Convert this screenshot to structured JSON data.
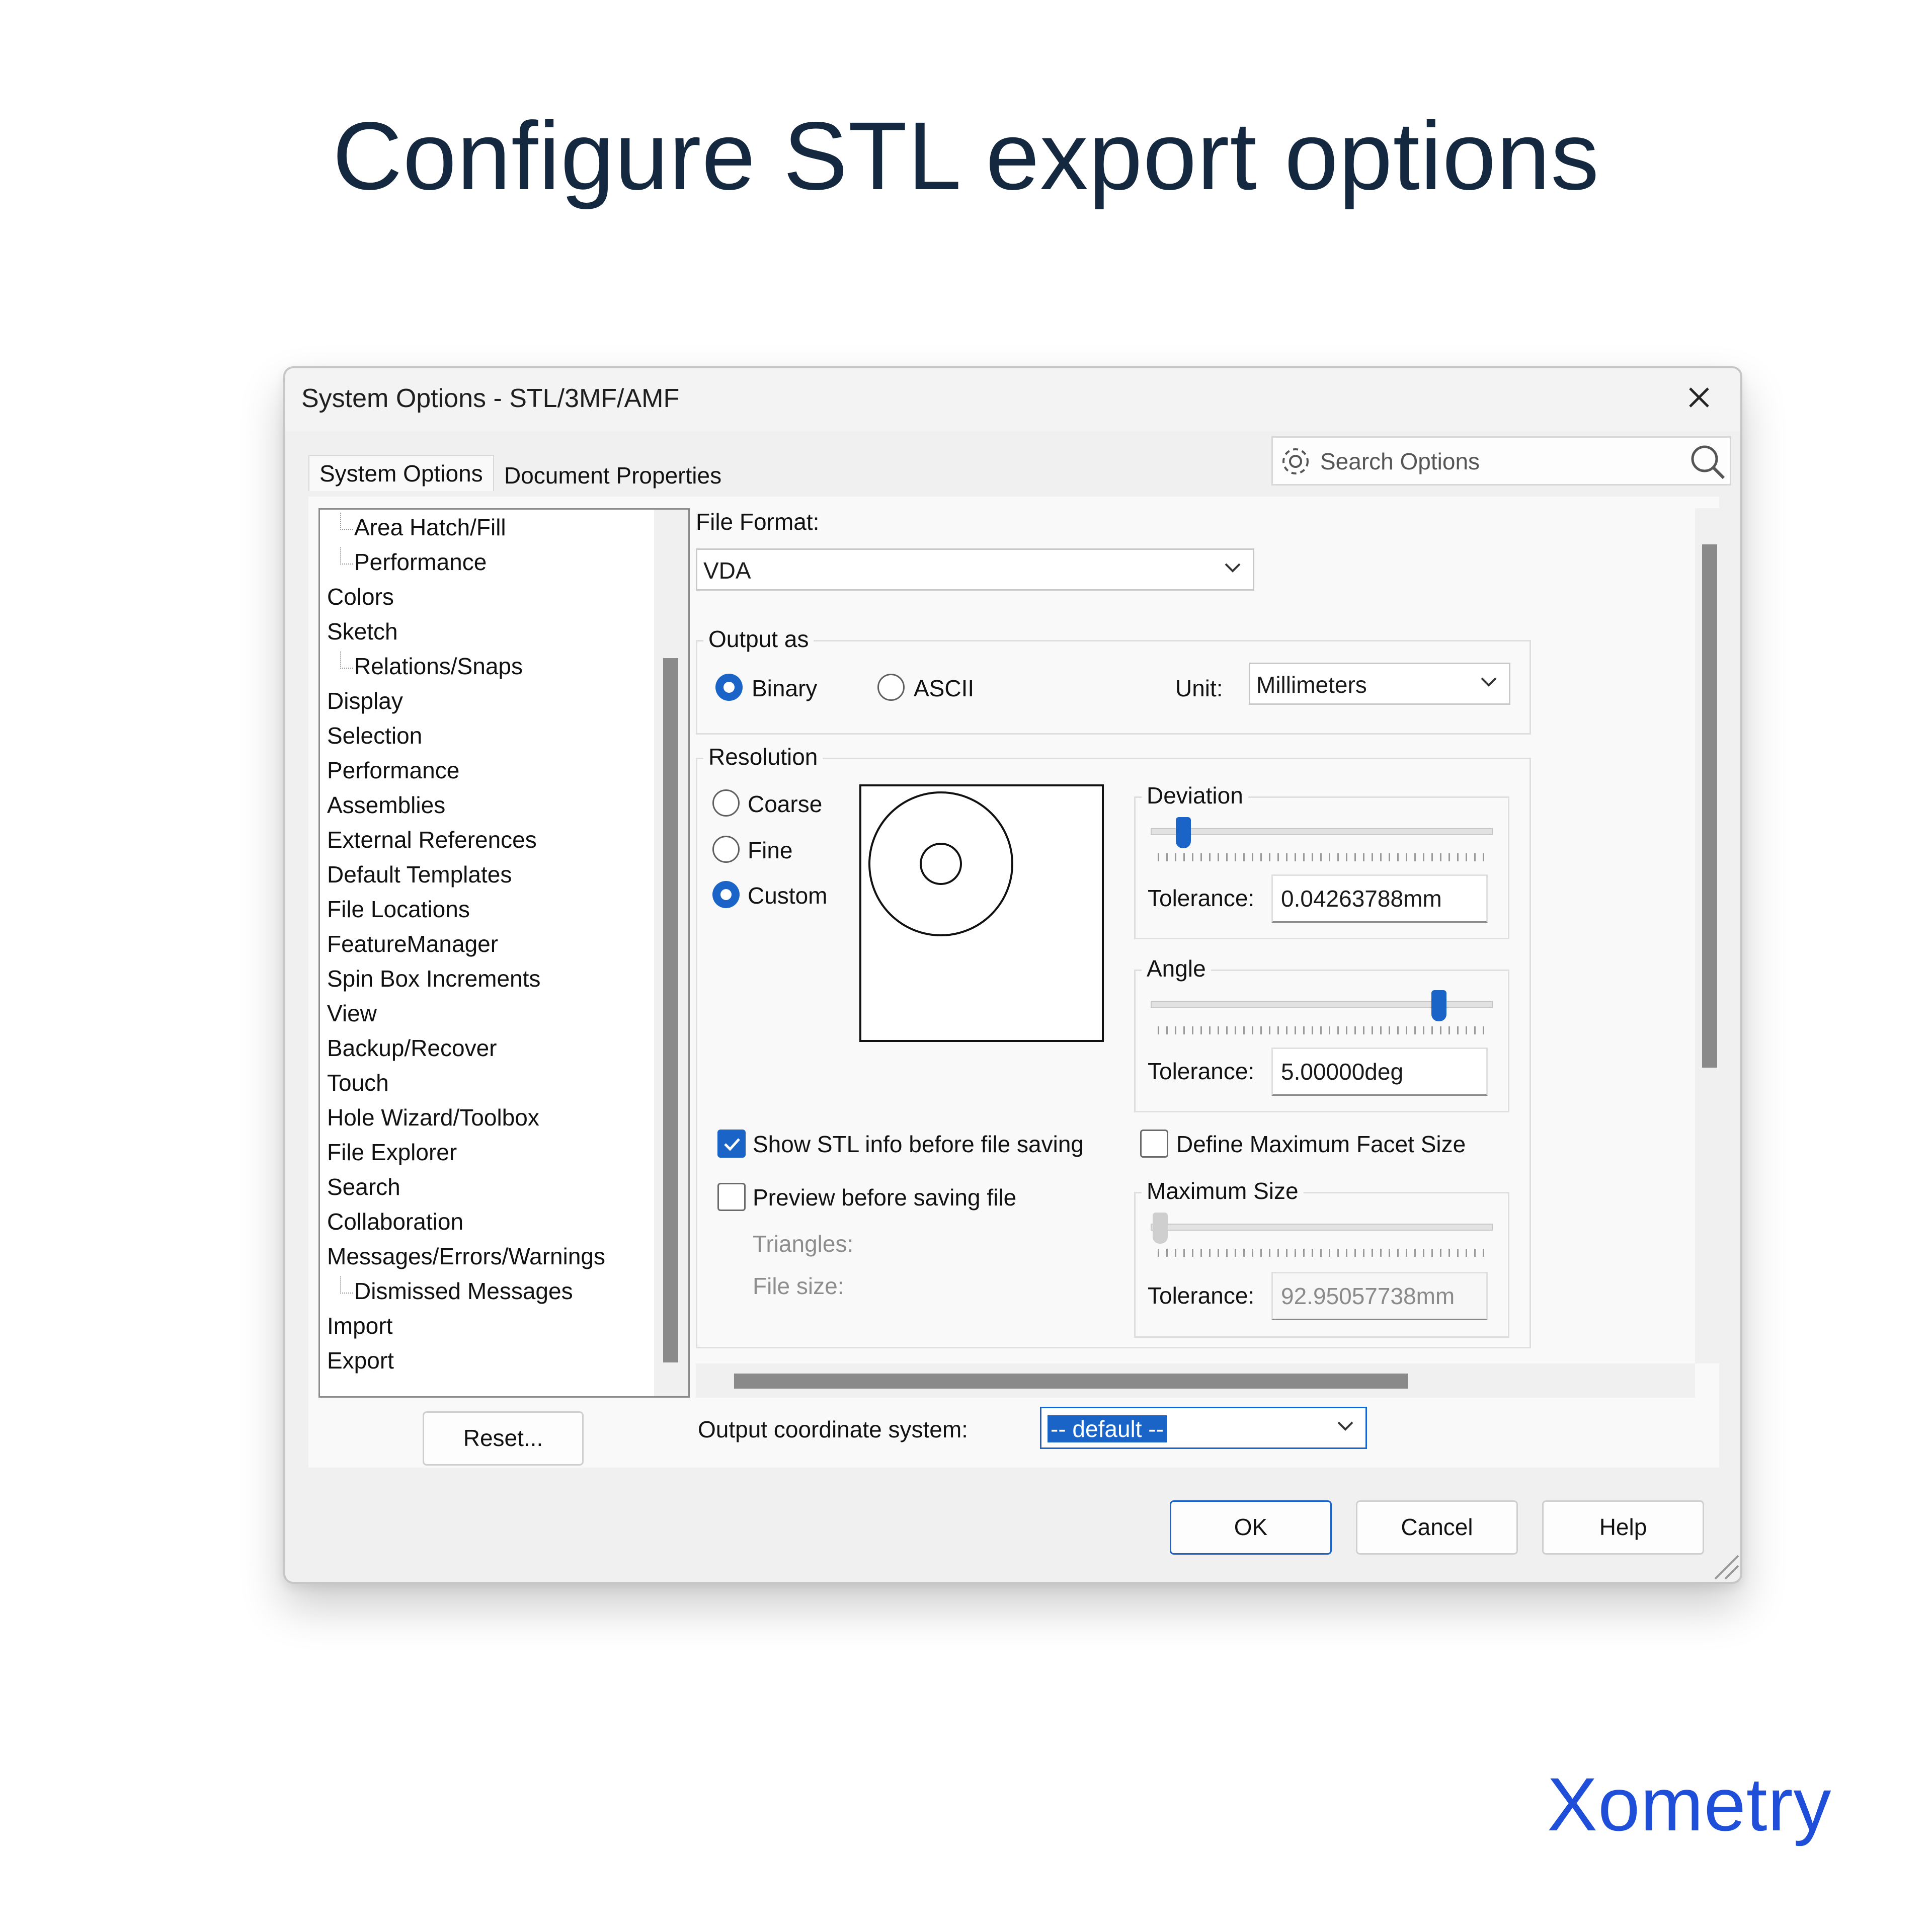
{
  "headline": "Configure STL export options",
  "dialog": {
    "title": "System Options - STL/3MF/AMF",
    "tabs": [
      "System Options",
      "Document Properties"
    ],
    "search_placeholder": "Search Options",
    "tree_items": [
      {
        "label": "Area Hatch/Fill",
        "indent": 1
      },
      {
        "label": "Performance",
        "indent": 1
      },
      {
        "label": "Colors",
        "indent": 0
      },
      {
        "label": "Sketch",
        "indent": 0
      },
      {
        "label": "Relations/Snaps",
        "indent": 1
      },
      {
        "label": "Display",
        "indent": 0
      },
      {
        "label": "Selection",
        "indent": 0
      },
      {
        "label": "Performance",
        "indent": 0
      },
      {
        "label": "Assemblies",
        "indent": 0
      },
      {
        "label": "External References",
        "indent": 0
      },
      {
        "label": "Default Templates",
        "indent": 0
      },
      {
        "label": "File Locations",
        "indent": 0
      },
      {
        "label": "FeatureManager",
        "indent": 0
      },
      {
        "label": "Spin Box Increments",
        "indent": 0
      },
      {
        "label": "View",
        "indent": 0
      },
      {
        "label": "Backup/Recover",
        "indent": 0
      },
      {
        "label": "Touch",
        "indent": 0
      },
      {
        "label": "Hole Wizard/Toolbox",
        "indent": 0
      },
      {
        "label": "File Explorer",
        "indent": 0
      },
      {
        "label": "Search",
        "indent": 0
      },
      {
        "label": "Collaboration",
        "indent": 0
      },
      {
        "label": "Messages/Errors/Warnings",
        "indent": 0
      },
      {
        "label": "Dismissed Messages",
        "indent": 1
      },
      {
        "label": "Import",
        "indent": 0
      },
      {
        "label": "Export",
        "indent": 0
      }
    ],
    "reset_label": "Reset...",
    "file_format_label": "File Format:",
    "file_format_value": "VDA",
    "output_as": {
      "title": "Output as",
      "options": [
        "Binary",
        "ASCII"
      ],
      "selected": "Binary",
      "unit_label": "Unit:",
      "unit_value": "Millimeters"
    },
    "resolution": {
      "title": "Resolution",
      "options": [
        "Coarse",
        "Fine",
        "Custom"
      ],
      "selected": "Custom",
      "deviation": {
        "title": "Deviation",
        "tolerance_label": "Tolerance:",
        "tolerance_value": "0.04263788mm",
        "slider_position": 0.09
      },
      "angle": {
        "title": "Angle",
        "tolerance_label": "Tolerance:",
        "tolerance_value": "5.00000deg",
        "slider_position": 0.84
      },
      "show_stl_info": {
        "label": "Show STL info before file saving",
        "checked": true
      },
      "preview": {
        "label": "Preview before saving file",
        "checked": false
      },
      "triangles_label": "Triangles:",
      "file_size_label": "File size:",
      "define_max_facet": {
        "label": "Define Maximum Facet Size",
        "checked": false
      },
      "maximum_size": {
        "title": "Maximum Size",
        "tolerance_label": "Tolerance:",
        "tolerance_value": "92.95057738mm",
        "slider_position": 0.0
      }
    },
    "output_coord_label": "Output coordinate system:",
    "output_coord_value": "-- default --",
    "buttons": {
      "ok": "OK",
      "cancel": "Cancel",
      "help": "Help"
    }
  },
  "logo": "Xometry",
  "colors": {
    "accent": "#1a64c8",
    "headline": "#14283f",
    "logo": "#1f4fd8"
  }
}
